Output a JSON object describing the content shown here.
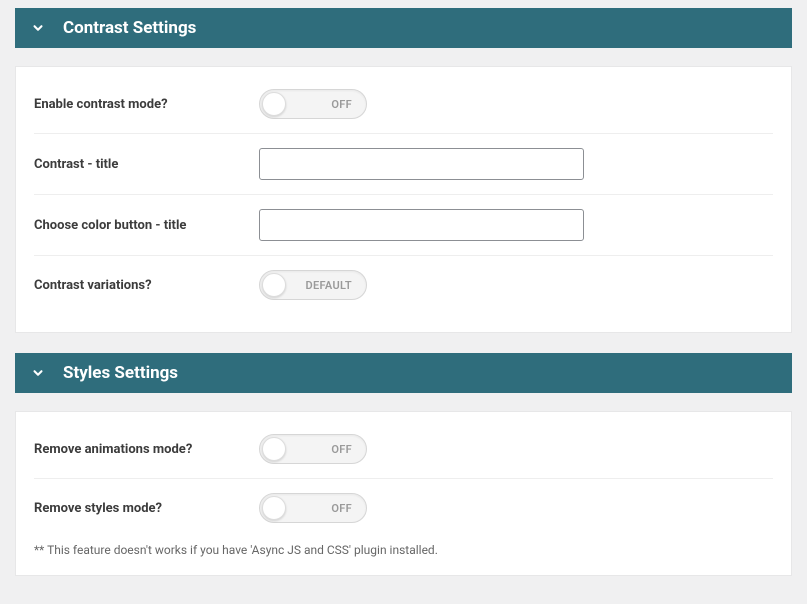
{
  "sections": {
    "contrast": {
      "title": "Contrast Settings",
      "fields": {
        "enable_mode": {
          "label": "Enable contrast mode?",
          "toggle_text": "OFF"
        },
        "contrast_title": {
          "label": "Contrast - title",
          "value": ""
        },
        "color_button_title": {
          "label": "Choose color button - title",
          "value": ""
        },
        "variations": {
          "label": "Contrast variations?",
          "toggle_text": "DEFAULT"
        }
      }
    },
    "styles": {
      "title": "Styles Settings",
      "fields": {
        "remove_animations": {
          "label": "Remove animations mode?",
          "toggle_text": "OFF"
        },
        "remove_styles": {
          "label": "Remove styles mode?",
          "toggle_text": "OFF"
        }
      },
      "note": "** This feature doesn't works if you have 'Async JS and CSS' plugin installed."
    }
  }
}
